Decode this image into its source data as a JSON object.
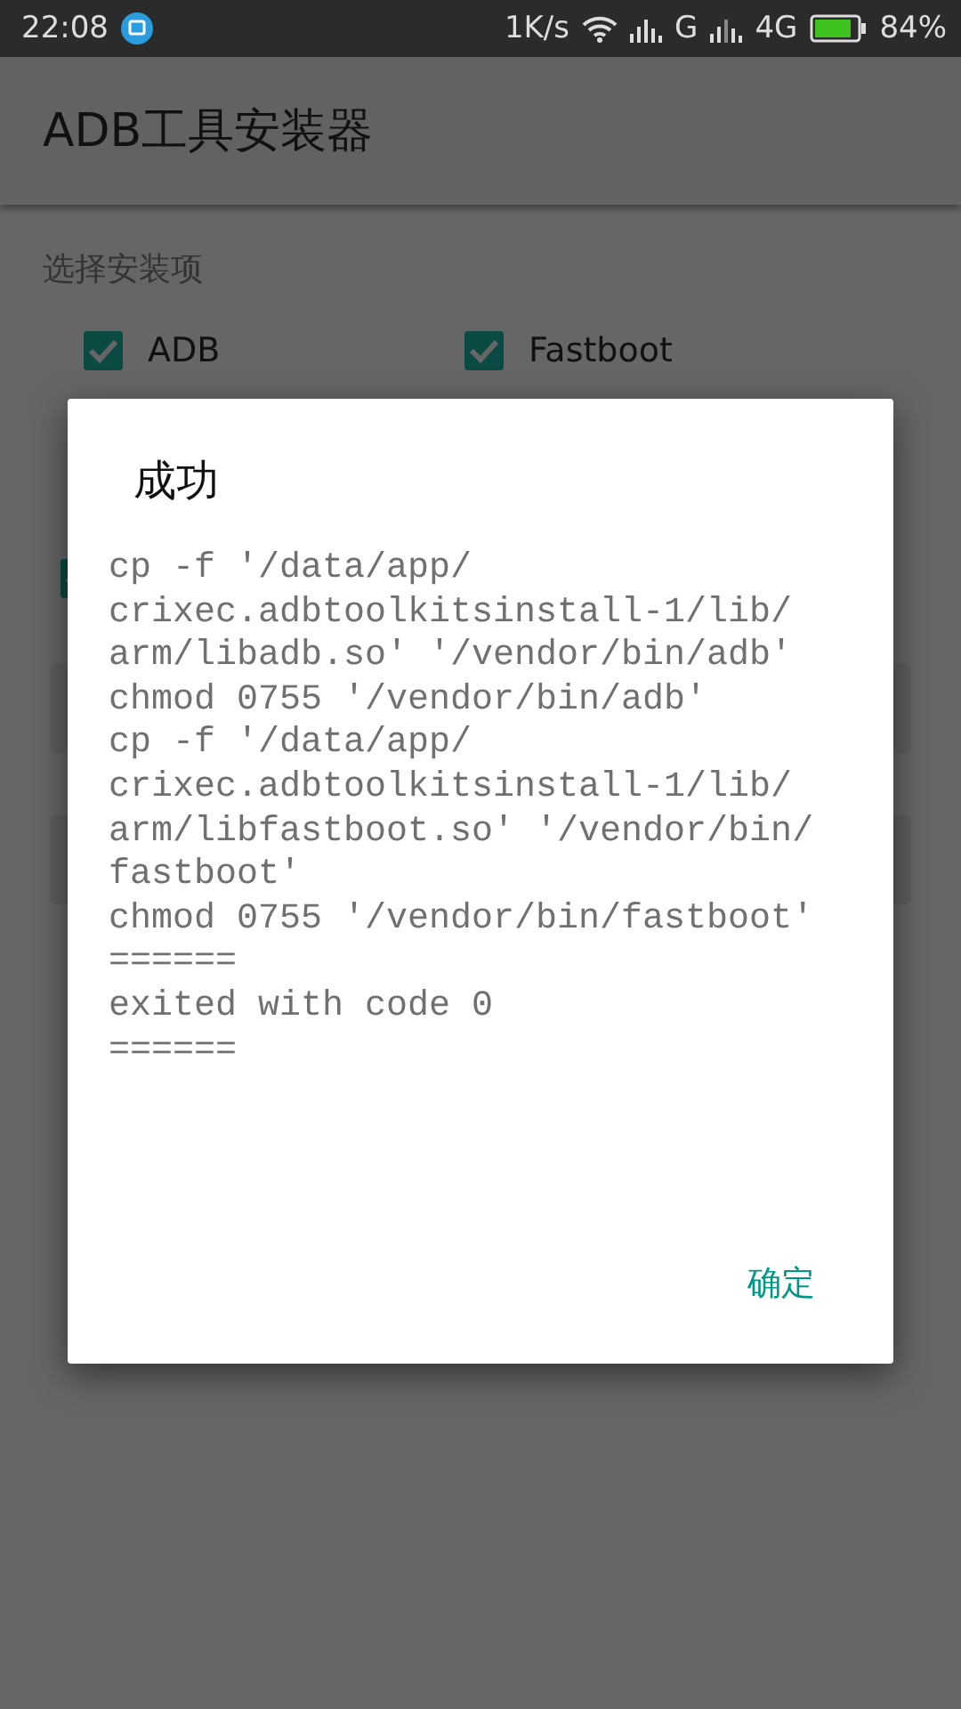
{
  "status_bar": {
    "time": "22:08",
    "speed": "1K/s",
    "network_1": "G",
    "network_2": "4G",
    "battery": "84%"
  },
  "app_bar": {
    "title": "ADB工具安装器"
  },
  "section": {
    "title": "选择安装项",
    "options": [
      {
        "label": "ADB",
        "checked": true
      },
      {
        "label": "Fastboot",
        "checked": true
      }
    ]
  },
  "lower_section": {
    "checkbox_checked": true
  },
  "dialog": {
    "title": "成功",
    "lines": [
      "cp -f '/data/app/",
      "crixec.adbtoolkitsinstall-1/lib/",
      "arm/libadb.so' '/vendor/bin/adb'",
      "chmod 0755 '/vendor/bin/adb'",
      "cp -f '/data/app/",
      "crixec.adbtoolkitsinstall-1/lib/",
      "arm/libfastboot.so' '/vendor/bin/",
      "fastboot'",
      "chmod 0755 '/vendor/bin/fastboot'",
      "======",
      "exited with code 0",
      "======"
    ],
    "button": "确定"
  }
}
